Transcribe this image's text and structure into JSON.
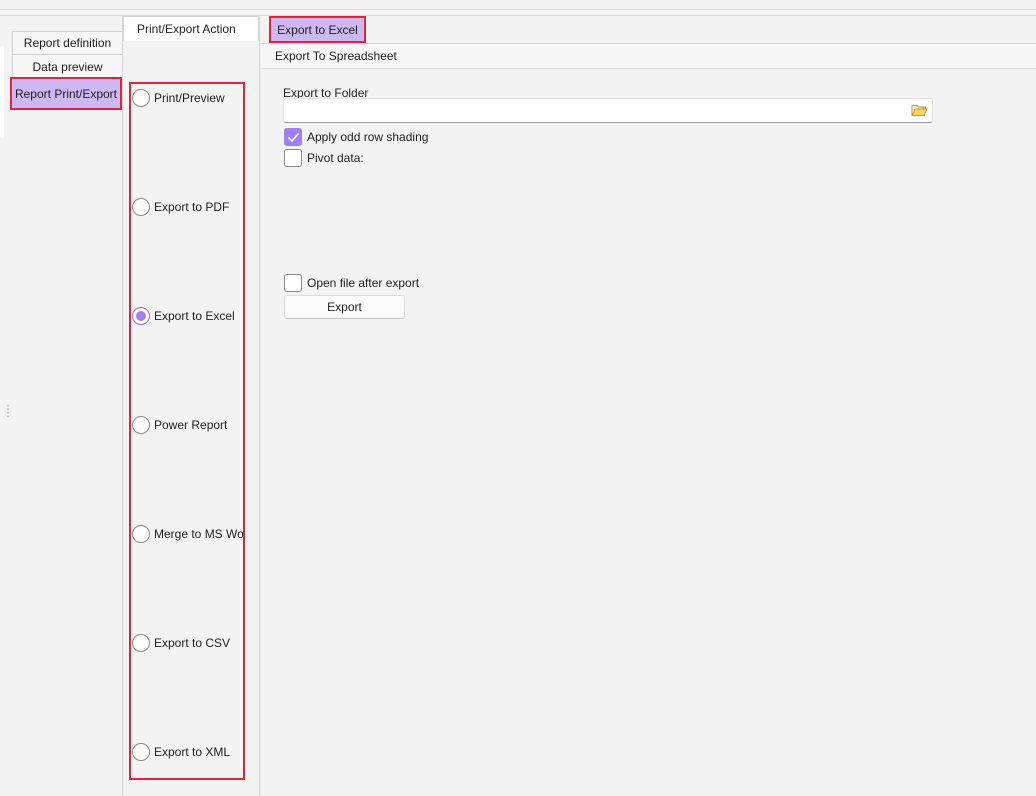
{
  "left_nav": {
    "tabs": [
      {
        "label": "Report definition"
      },
      {
        "label": "Data preview"
      },
      {
        "label": "Report Print/Export"
      }
    ],
    "active_index": 2
  },
  "action_panel": {
    "tab_label": "Print/Export Action",
    "options": [
      {
        "label": "Print/Preview",
        "selected": false
      },
      {
        "label": "Export to PDF",
        "selected": false
      },
      {
        "label": "Export to Excel",
        "selected": true
      },
      {
        "label": "Power Report",
        "selected": false
      },
      {
        "label": "Merge to MS Word",
        "selected": false
      },
      {
        "label": "Export to CSV",
        "selected": false
      },
      {
        "label": "Export to XML",
        "selected": false
      }
    ]
  },
  "content": {
    "tab_label": "Export to Excel",
    "subtab_label": "Export To Spreadsheet",
    "folder_label": "Export to Folder",
    "folder_value": "",
    "apply_shading_label": "Apply odd row shading",
    "apply_shading_checked": true,
    "pivot_label": "Pivot data:",
    "pivot_checked": false,
    "open_after_label": "Open file after export",
    "open_after_checked": false,
    "export_button": "Export"
  },
  "colors": {
    "accent": "#a27ff0",
    "highlight_bg": "#cdb8f3",
    "annotation_red": "#e0253a"
  },
  "icons": {
    "folder": "folder-open-icon",
    "check": "check-icon",
    "grip": "grip-handle-icon"
  }
}
